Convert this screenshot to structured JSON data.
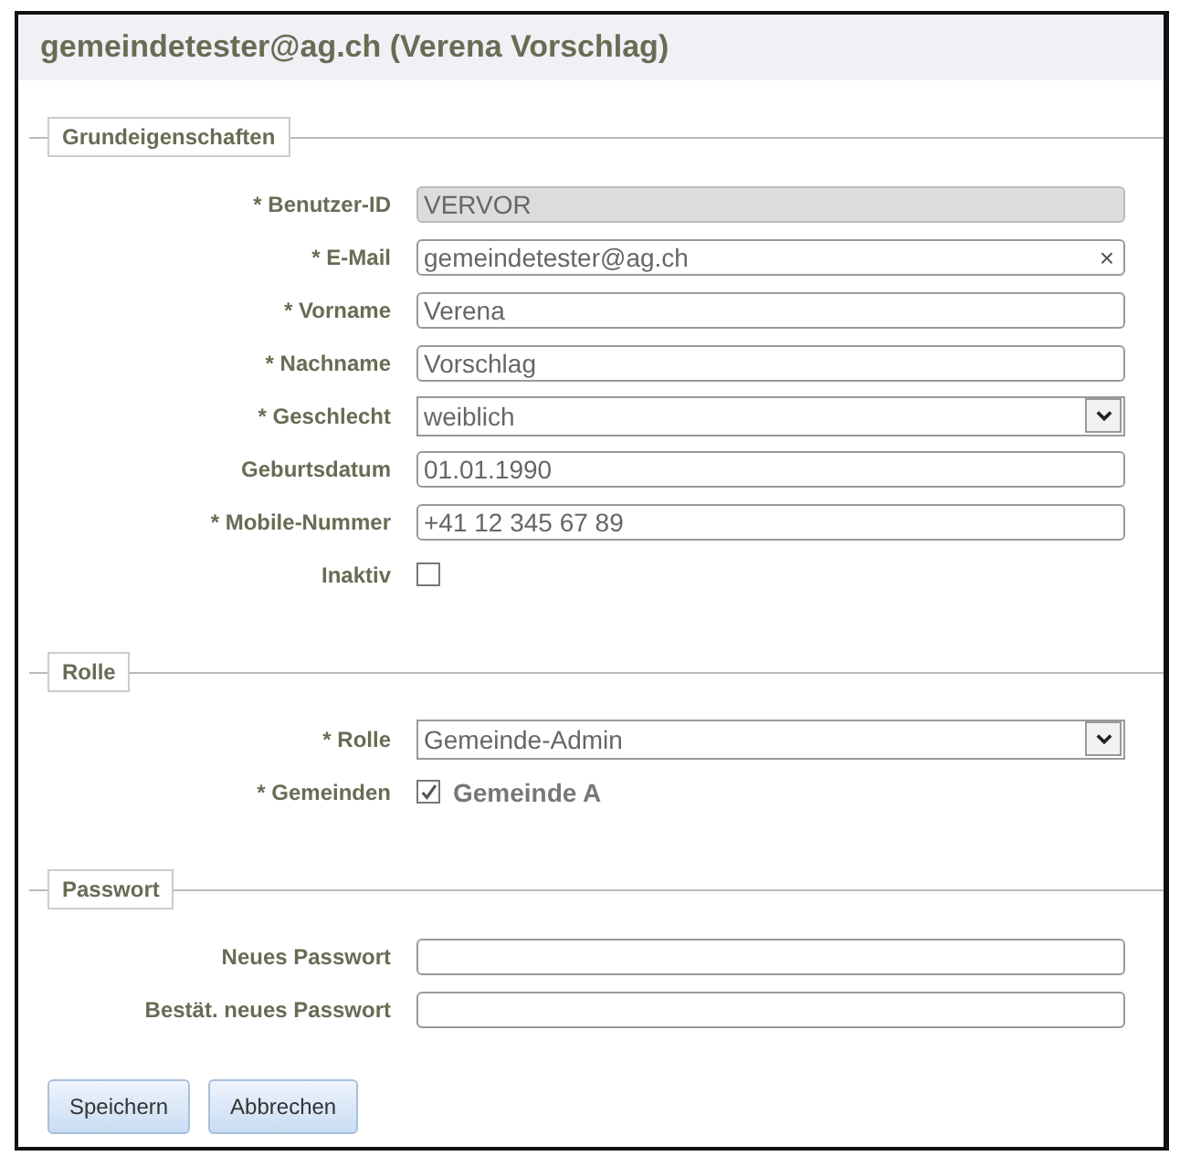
{
  "title": "gemeindetester@ag.ch (Verena Vorschlag)",
  "sections": [
    {
      "legend": "Grundeigenschaften",
      "fields": [
        {
          "kind": "text",
          "label": "* Benutzer-ID",
          "value": "VERVOR",
          "disabled": true
        },
        {
          "kind": "text",
          "label": "* E-Mail",
          "value": "gemeindetester@ag.ch",
          "disabled": false,
          "clear_icon": "×"
        },
        {
          "kind": "text",
          "label": "* Vorname",
          "value": "Verena",
          "disabled": false
        },
        {
          "kind": "text",
          "label": "* Nachname",
          "value": "Vorschlag",
          "disabled": false
        },
        {
          "kind": "select",
          "label": "* Geschlecht",
          "value": "weiblich"
        },
        {
          "kind": "text",
          "label": "Geburtsdatum",
          "value": "01.01.1990",
          "disabled": false
        },
        {
          "kind": "text",
          "label": "* Mobile-Nummer",
          "value": "+41 12 345 67 89",
          "disabled": false
        },
        {
          "kind": "checkbox",
          "label": "Inaktiv",
          "checked": false
        }
      ]
    },
    {
      "legend": "Rolle",
      "fields": [
        {
          "kind": "select",
          "label": "* Rolle",
          "value": "Gemeinde-Admin"
        },
        {
          "kind": "option",
          "label": "* Gemeinden",
          "option": "Gemeinde A",
          "checked": true
        }
      ]
    },
    {
      "legend": "Passwort",
      "fields": [
        {
          "kind": "text",
          "label": "Neues Passwort",
          "disabled": false
        },
        {
          "kind": "text",
          "label": "Bestät. neues Passwort",
          "disabled": false
        }
      ]
    }
  ],
  "buttons": [
    "Speichern",
    "Abbrechen"
  ]
}
